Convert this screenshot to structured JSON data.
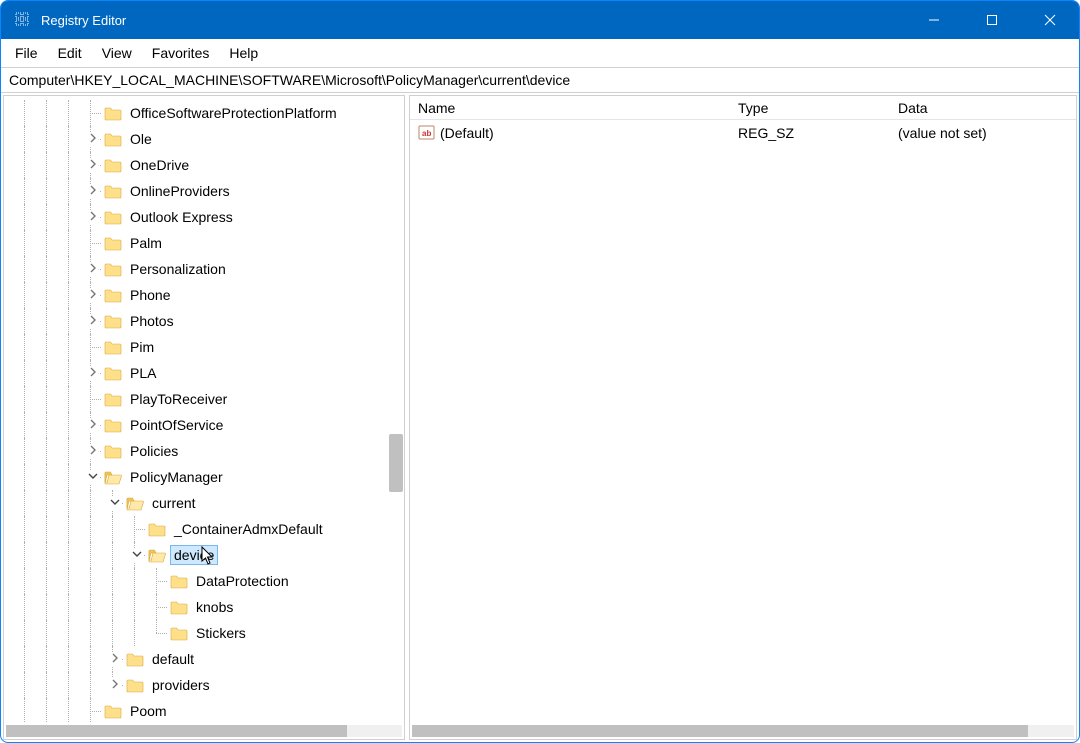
{
  "window": {
    "title": "Registry Editor"
  },
  "menubar": [
    "File",
    "Edit",
    "View",
    "Favorites",
    "Help"
  ],
  "address": "Computer\\HKEY_LOCAL_MACHINE\\SOFTWARE\\Microsoft\\PolicyManager\\current\\device",
  "tree": [
    {
      "depth": 3,
      "expander": "",
      "label": "OfficeSoftwareProtectionPlatform"
    },
    {
      "depth": 3,
      "expander": ">",
      "label": "Ole"
    },
    {
      "depth": 3,
      "expander": ">",
      "label": "OneDrive"
    },
    {
      "depth": 3,
      "expander": ">",
      "label": "OnlineProviders"
    },
    {
      "depth": 3,
      "expander": ">",
      "label": "Outlook Express"
    },
    {
      "depth": 3,
      "expander": "",
      "label": "Palm"
    },
    {
      "depth": 3,
      "expander": ">",
      "label": "Personalization"
    },
    {
      "depth": 3,
      "expander": ">",
      "label": "Phone"
    },
    {
      "depth": 3,
      "expander": ">",
      "label": "Photos"
    },
    {
      "depth": 3,
      "expander": "",
      "label": "Pim"
    },
    {
      "depth": 3,
      "expander": ">",
      "label": "PLA"
    },
    {
      "depth": 3,
      "expander": "",
      "label": "PlayToReceiver"
    },
    {
      "depth": 3,
      "expander": ">",
      "label": "PointOfService"
    },
    {
      "depth": 3,
      "expander": ">",
      "label": "Policies"
    },
    {
      "depth": 3,
      "expander": "v",
      "label": "PolicyManager",
      "open": true
    },
    {
      "depth": 4,
      "expander": "v",
      "label": "current",
      "open": true
    },
    {
      "depth": 5,
      "expander": "",
      "label": "_ContainerAdmxDefault"
    },
    {
      "depth": 5,
      "expander": "v",
      "label": "device",
      "open": true,
      "selected": true
    },
    {
      "depth": 6,
      "expander": "",
      "label": "DataProtection"
    },
    {
      "depth": 6,
      "expander": "",
      "label": "knobs"
    },
    {
      "depth": 6,
      "expander": "",
      "label": "Stickers",
      "last": true
    },
    {
      "depth": 4,
      "expander": ">",
      "label": "default"
    },
    {
      "depth": 4,
      "expander": ">",
      "label": "providers",
      "last": true
    },
    {
      "depth": 3,
      "expander": "",
      "label": "Poom"
    }
  ],
  "list": {
    "columns": {
      "name": "Name",
      "type": "Type",
      "data": "Data"
    },
    "rows": [
      {
        "name": "(Default)",
        "type": "REG_SZ",
        "data": "(value not set)"
      }
    ]
  }
}
